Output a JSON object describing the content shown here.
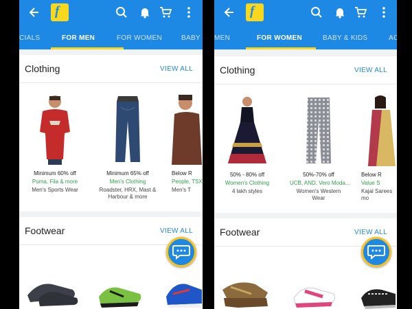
{
  "left": {
    "tabs": [
      {
        "label": "CIALS",
        "active": false
      },
      {
        "label": "FOR MEN",
        "active": true
      },
      {
        "label": "FOR WOMEN",
        "active": false
      },
      {
        "label": "BABY",
        "active": false
      }
    ],
    "clothing": {
      "title": "Clothing",
      "view_all": "VIEW ALL",
      "products": [
        {
          "offer": "Minimum 60% off",
          "brands": "Puma, Fila & more",
          "category": "Men's Sports Wear",
          "category2": ""
        },
        {
          "offer": "Minimum 65% off",
          "brands": "Men's Clothing",
          "category": "Roadster, HRX, Mast &",
          "category2": "Harbour & more"
        },
        {
          "offer": "Below R",
          "brands": "People, TSX",
          "category": "Men's T",
          "category2": ""
        }
      ]
    },
    "footwear": {
      "title": "Footwear",
      "view_all": "VIEW ALL"
    }
  },
  "right": {
    "tabs": [
      {
        "label": "MEN",
        "active": false
      },
      {
        "label": "FOR WOMEN",
        "active": true
      },
      {
        "label": "BABY & KIDS",
        "active": false
      },
      {
        "label": "AC",
        "active": false
      }
    ],
    "clothing": {
      "title": "Clothing",
      "view_all": "VIEW ALL",
      "products": [
        {
          "offer": "50% - 80% off",
          "brands": "Women's Clothing",
          "category": "4 lakh styles",
          "category2": ""
        },
        {
          "offer": "50%-70% off",
          "brands": "UCB, AND, Vero Moda...",
          "category": "Women's Western",
          "category2": "Wear"
        },
        {
          "offer": "Below R",
          "brands": "Value S",
          "category": "Kajal Sarees",
          "category2": "mo"
        }
      ]
    },
    "footwear": {
      "title": "Footwear",
      "view_all": "VIEW ALL"
    }
  },
  "colors": {
    "primary": "#1e88e5",
    "accent": "#f9d71c",
    "offer_green": "#2ea04b"
  },
  "icons": [
    "back-arrow-icon",
    "flipkart-logo",
    "search-icon",
    "bell-icon",
    "cart-icon",
    "more-vert-icon",
    "chat-icon"
  ]
}
